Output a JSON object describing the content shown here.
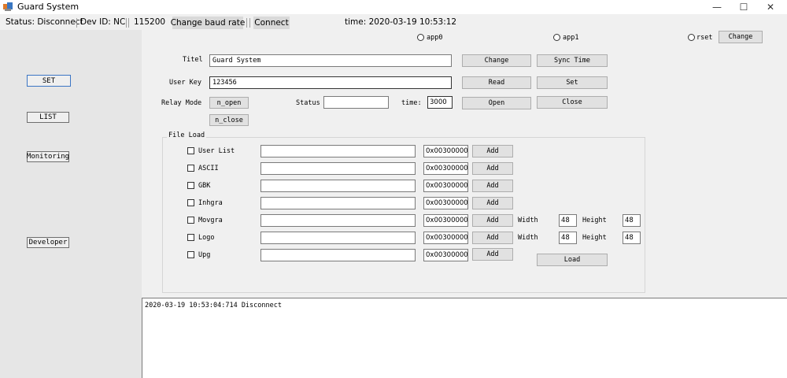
{
  "window": {
    "title": "Guard System",
    "minimize_glyph": "—",
    "maximize_glyph": "☐",
    "close_glyph": "✕"
  },
  "status_strip": {
    "status": "Status:  Disconnect",
    "dev_id": "Dev ID:  NC",
    "baud": "115200",
    "change_baud_label": "Change baud rate",
    "connect_label": "Connect",
    "time": "time: 2020-03-19 10:53:12"
  },
  "nav": {
    "set": "SET",
    "list": "LIST",
    "monitoring": "Monitoring",
    "developer": "Developer"
  },
  "radios": {
    "app0": "app0",
    "app1": "app1",
    "rset": "rset"
  },
  "change_top_label": "Change",
  "form": {
    "titel_label": "Titel",
    "titel_value": "Guard System",
    "user_key_label": "User Key",
    "user_key_value": "123456",
    "relay_mode_label": "Relay Mode",
    "n_open": "n_open",
    "n_close": "n_close",
    "status_label": "Status",
    "status_value": "",
    "time_label": "time:",
    "time_value": "3000",
    "change_btn": "Change",
    "sync_time_btn": "Sync Time",
    "read_btn": "Read",
    "set_btn": "Set",
    "open_btn": "Open",
    "close_btn": "Close"
  },
  "file_load": {
    "legend": "File Load",
    "items": [
      {
        "label": "User List",
        "path": "",
        "addr": "0x00300000",
        "add": "Add"
      },
      {
        "label": "ASCII",
        "path": "",
        "addr": "0x00300000",
        "add": "Add"
      },
      {
        "label": "GBK",
        "path": "",
        "addr": "0x00300000",
        "add": "Add"
      },
      {
        "label": "Inhgra",
        "path": "",
        "addr": "0x00300000",
        "add": "Add"
      },
      {
        "label": "Movgra",
        "path": "",
        "addr": "0x00300000",
        "add": "Add"
      },
      {
        "label": "Logo",
        "path": "",
        "addr": "0x00300000",
        "add": "Add"
      },
      {
        "label": "Upg",
        "path": "",
        "addr": "0x00300000",
        "add": "Add"
      }
    ],
    "movgra_size": {
      "width_label": "Width",
      "width": "48",
      "height_label": "Height",
      "height": "48"
    },
    "logo_size": {
      "width_label": "Width",
      "width": "48",
      "height_label": "Height",
      "height": "48"
    },
    "load_btn": "Load"
  },
  "log": {
    "lines": [
      "2020-03-19 10:53:04:714  Disconnect"
    ]
  },
  "colors": {
    "window_bg": "#f0f0f0",
    "left_panel_bg": "#e6e6e6",
    "button_bg": "#e1e1e1"
  }
}
